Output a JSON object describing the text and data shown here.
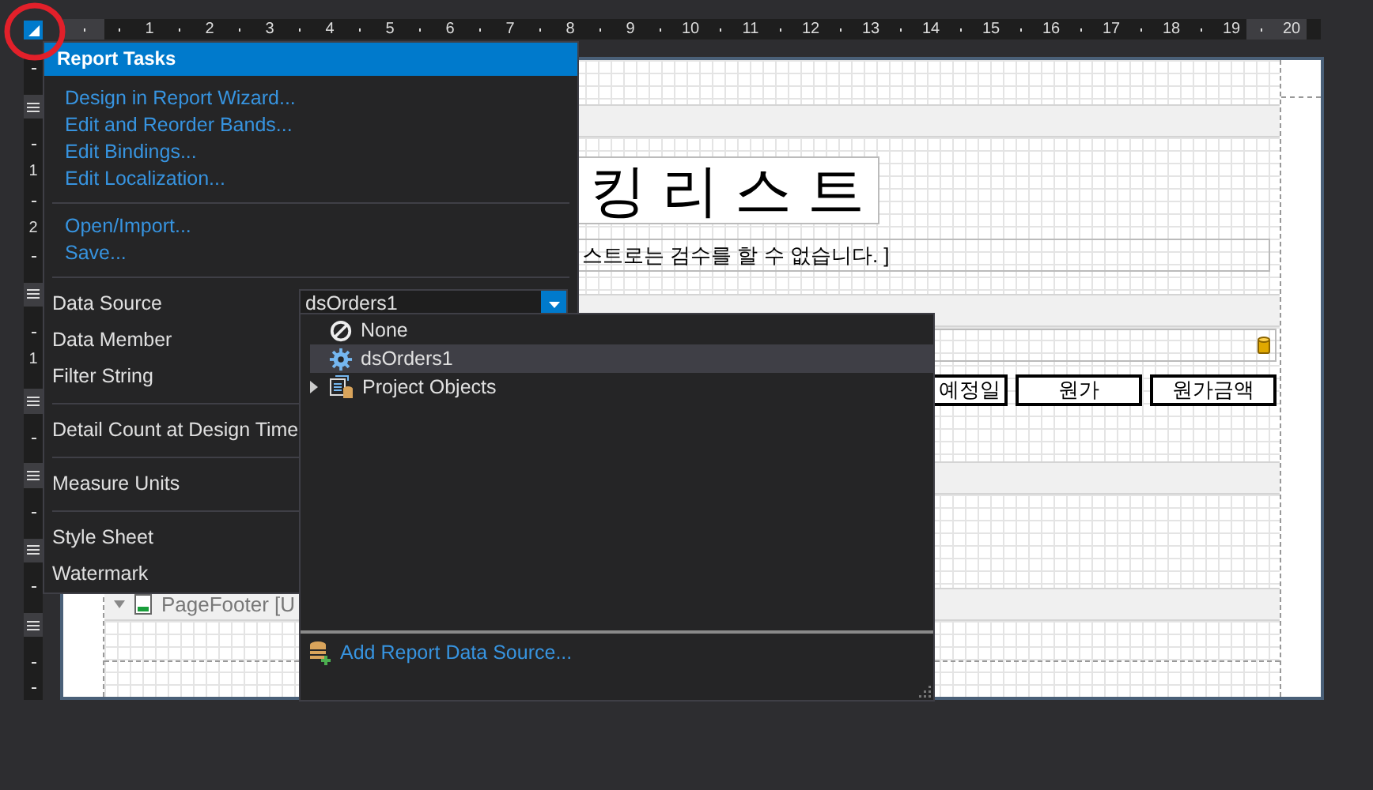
{
  "ruler": {
    "ticks": [
      "1",
      "2",
      "3",
      "4",
      "5",
      "6",
      "7",
      "8",
      "9",
      "10",
      "11",
      "12",
      "13",
      "14",
      "15",
      "16",
      "17",
      "18",
      "19",
      "20"
    ]
  },
  "side_ruler": [
    {
      "kind": "tick"
    },
    {
      "kind": "handle"
    },
    {
      "kind": "tick"
    },
    {
      "kind": "label",
      "text": "1"
    },
    {
      "kind": "tick"
    },
    {
      "kind": "label",
      "text": "2"
    },
    {
      "kind": "tick"
    },
    {
      "kind": "handle"
    },
    {
      "kind": "tick"
    },
    {
      "kind": "label",
      "text": "1"
    },
    {
      "kind": "handle"
    },
    {
      "kind": "tick"
    },
    {
      "kind": "handle"
    },
    {
      "kind": "tick"
    },
    {
      "kind": "handle"
    },
    {
      "kind": "tick"
    },
    {
      "kind": "handle"
    },
    {
      "kind": "tick"
    },
    {
      "kind": "tick"
    }
  ],
  "report": {
    "title": "킹 리 스 트",
    "subtitle": "스트로는 검수를 할 수 없습니다. ]",
    "columns": [
      "예정일",
      "원가",
      "원가금액"
    ],
    "footer_band": "PageFooter [U"
  },
  "tasks": {
    "title": "Report Tasks",
    "link_groups": [
      [
        "Design in Report Wizard...",
        "Edit and Reorder Bands...",
        "Edit Bindings...",
        "Edit Localization..."
      ],
      [
        "Open/Import...",
        "Save..."
      ]
    ],
    "property_groups": [
      [
        {
          "label": "Data Source",
          "value": "dsOrders1"
        },
        {
          "label": "Data Member"
        },
        {
          "label": "Filter String"
        }
      ],
      [
        {
          "label": "Detail Count at Design Time"
        }
      ],
      [
        {
          "label": "Measure Units"
        }
      ],
      [
        {
          "label": "Style Sheet"
        },
        {
          "label": "Watermark"
        }
      ]
    ]
  },
  "dropdown": {
    "items": [
      {
        "kind": "none",
        "label": "None",
        "selected": false
      },
      {
        "kind": "source",
        "label": "dsOrders1",
        "selected": true
      },
      {
        "kind": "folder",
        "label": "Project Objects",
        "selected": false,
        "expanded": false
      }
    ],
    "footer_link": "Add Report Data Source..."
  }
}
